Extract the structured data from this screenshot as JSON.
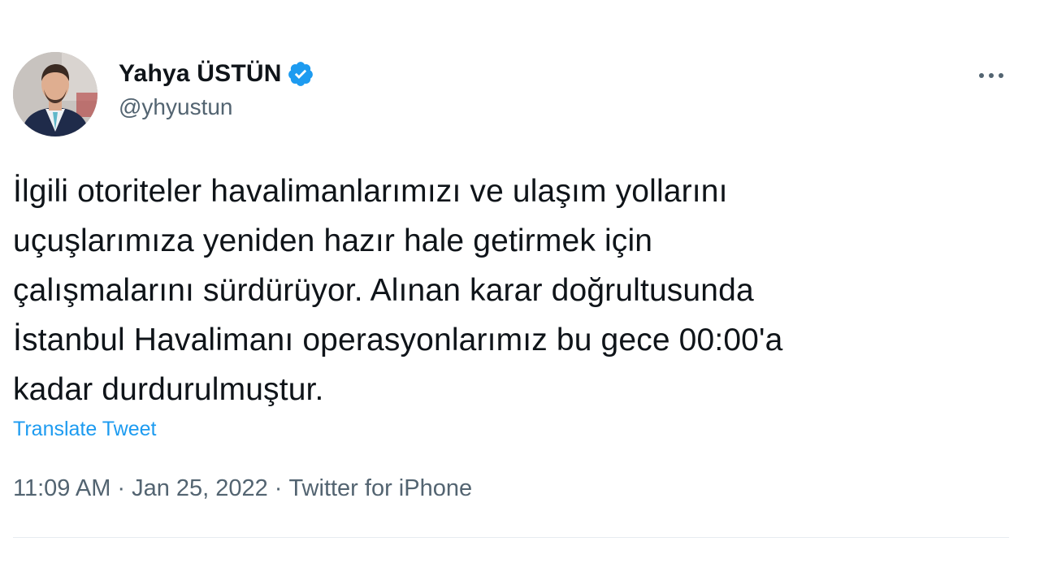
{
  "author": {
    "display_name": "Yahya ÜSTÜN",
    "handle": "@yhyustun",
    "verified": true,
    "verified_color": "#1d9bf0"
  },
  "more_icon": "more-horizontal-icon",
  "tweet": {
    "text_lines": [
      "İlgili otoriteler havalimanlarımızı ve ulaşım yollarını",
      "uçuşlarımıza yeniden hazır hale getirmek için",
      "çalışmalarını sürdürüyor. Alınan karar doğrultusunda",
      "İstanbul Havalimanı operasyonlarımız bu gece 00:00'a",
      "kadar durdurulmuştur."
    ],
    "translate_label": "Translate Tweet"
  },
  "meta": {
    "time": "11:09 AM",
    "separator": "·",
    "date": "Jan 25, 2022",
    "source": "Twitter for iPhone"
  },
  "colors": {
    "text": "#0f1419",
    "secondary": "#536471",
    "link": "#1d9bf0",
    "divider": "#e6ecf0"
  }
}
